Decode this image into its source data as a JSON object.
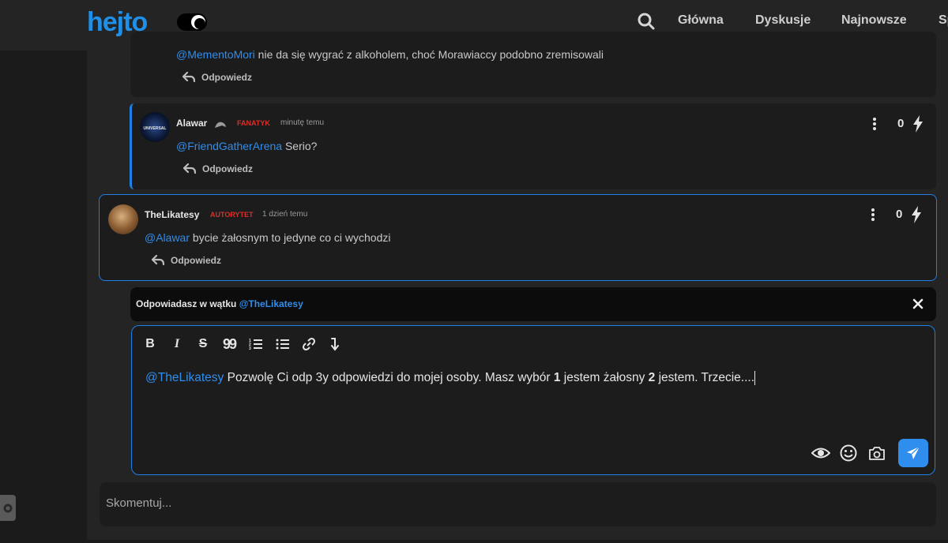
{
  "header": {
    "logo_text": "hejto",
    "nav": [
      "Główna",
      "Dyskusje",
      "Najnowsze",
      "Sp"
    ]
  },
  "comments": [
    {
      "mention": "@MementoMori",
      "text": " nie da się wygrać z alkoholem, choć Morawiaccy podobno zremisowali",
      "reply_label": "Odpowiedz"
    },
    {
      "author": "Alawar",
      "rank": "FANATYK",
      "time": "minutę temu",
      "mention": "@FriendGatherArena",
      "text": " Serio?",
      "score": "0",
      "reply_label": "Odpowiedz",
      "avatar_label": "UNIVERSAL"
    },
    {
      "author": "TheLikatesy",
      "rank": "AUTORYTET",
      "time": "1 dzień temu",
      "mention": "@Alawar",
      "text": " bycie żałosnym to jedyne co ci wychodzi",
      "score": "0",
      "reply_label": "Odpowiedz"
    }
  ],
  "reply_banner": {
    "prefix": "Odpowiadasz w wątku ",
    "target": "@TheLikatesy"
  },
  "editor": {
    "toolbar": [
      "B",
      "I",
      "S",
      "99",
      "ordered-list",
      "unordered-list",
      "link",
      "arrow-down"
    ],
    "mention": "@TheLikatesy",
    "text_1": " Pozwolę Ci odp 3y odpowiedzi do mojej osoby. Masz wybór ",
    "bold_1": "1",
    "text_2": " jestem żałosny ",
    "bold_2": "2",
    "text_3": " jestem. Trzecie...."
  },
  "comment_input": {
    "placeholder": "Skomentuj..."
  },
  "colors": {
    "accent": "#2f8ded",
    "rank_red": "#d9302c",
    "background": "#1b1b1b"
  }
}
